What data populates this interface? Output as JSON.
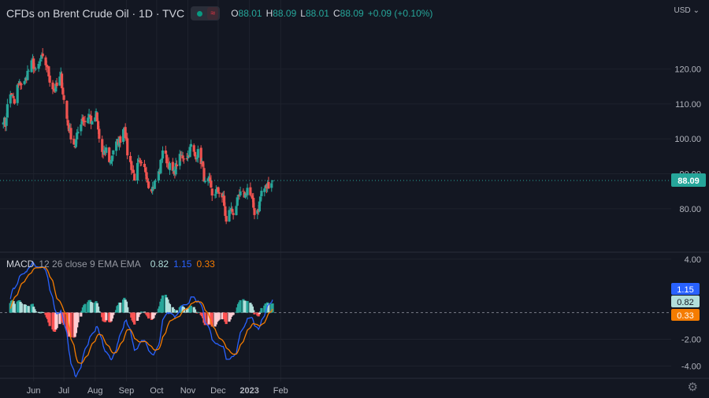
{
  "header": {
    "title": "CFDs on Brent Crude Oil · 1D · TVC",
    "open_label": "O",
    "open": "88.01",
    "high_label": "H",
    "high": "88.09",
    "low_label": "L",
    "low": "88.01",
    "close_label": "C",
    "close": "88.09",
    "change": "+0.09 (+0.10%)",
    "toggle_icon": "eye-dot-icon",
    "wave_icon": "wave-icon"
  },
  "currency": "USD",
  "currency_icon": "chevron-down-icon",
  "settings_icon": "gear-icon",
  "colors": {
    "background": "#131722",
    "grid": "#1e222d",
    "up": "#26a69a",
    "down": "#ef5350",
    "macd_line": "#2962ff",
    "signal_line": "#f57c00",
    "hist_up_strong": "#26a69a",
    "hist_up_weak": "#b2dfdb",
    "hist_down_strong": "#ff5252",
    "hist_down_weak": "#ffcdd2"
  },
  "macd_header": {
    "name": "MACD",
    "params": "12 26 close 9 EMA EMA",
    "hist_value": "0.82",
    "macd_value": "1.15",
    "signal_value": "0.33"
  },
  "chart_data": [
    {
      "type": "candlestick",
      "title": "CFDs on Brent Crude Oil · 1D · TVC",
      "ylim": [
        68,
        133
      ],
      "y_ticks": [
        80,
        90,
        100,
        110,
        120
      ],
      "y_tick_labels": [
        "80.00",
        "90.00",
        "100.00",
        "110.00",
        "120.00"
      ],
      "last_price": 88.09,
      "last_price_label": "88.09",
      "x_tick_labels": [
        "Jun",
        "Jul",
        "Aug",
        "Sep",
        "Oct",
        "Nov",
        "Dec",
        "2023",
        "Feb"
      ],
      "close_anchors": [
        [
          "2022-05-01",
          107
        ],
        [
          "2022-05-04",
          104
        ],
        [
          "2022-05-07",
          112
        ],
        [
          "2022-05-10",
          113
        ],
        [
          "2022-05-13",
          110
        ],
        [
          "2022-05-16",
          115
        ],
        [
          "2022-05-19",
          116
        ],
        [
          "2022-05-23",
          116
        ],
        [
          "2022-05-26",
          119
        ],
        [
          "2022-05-31",
          122
        ],
        [
          "2022-06-03",
          119
        ],
        [
          "2022-06-06",
          121
        ],
        [
          "2022-06-09",
          123
        ],
        [
          "2022-06-14",
          121
        ],
        [
          "2022-06-17",
          117
        ],
        [
          "2022-06-21",
          114
        ],
        [
          "2022-06-24",
          115
        ],
        [
          "2022-06-28",
          118
        ],
        [
          "2022-07-01",
          111
        ],
        [
          "2022-07-05",
          104
        ],
        [
          "2022-07-08",
          101
        ],
        [
          "2022-07-12",
          98
        ],
        [
          "2022-07-15",
          102
        ],
        [
          "2022-07-19",
          106
        ],
        [
          "2022-07-22",
          105
        ],
        [
          "2022-07-26",
          107
        ],
        [
          "2022-07-29",
          104
        ],
        [
          "2022-08-02",
          107
        ],
        [
          "2022-08-05",
          100
        ],
        [
          "2022-08-09",
          95
        ],
        [
          "2022-08-12",
          97
        ],
        [
          "2022-08-16",
          93
        ],
        [
          "2022-08-19",
          97
        ],
        [
          "2022-08-23",
          99
        ],
        [
          "2022-08-26",
          100
        ],
        [
          "2022-08-30",
          104
        ],
        [
          "2022-09-02",
          96
        ],
        [
          "2022-09-06",
          92
        ],
        [
          "2022-09-09",
          89
        ],
        [
          "2022-09-13",
          93
        ],
        [
          "2022-09-16",
          92
        ],
        [
          "2022-09-20",
          91
        ],
        [
          "2022-09-23",
          87
        ],
        [
          "2022-09-27",
          86
        ],
        [
          "2022-09-30",
          88
        ],
        [
          "2022-10-04",
          91
        ],
        [
          "2022-10-07",
          97
        ],
        [
          "2022-10-11",
          94
        ],
        [
          "2022-10-14",
          92
        ],
        [
          "2022-10-18",
          90
        ],
        [
          "2022-10-21",
          93
        ],
        [
          "2022-10-25",
          95
        ],
        [
          "2022-10-28",
          95
        ],
        [
          "2022-11-01",
          95
        ],
        [
          "2022-11-04",
          98
        ],
        [
          "2022-11-08",
          95
        ],
        [
          "2022-11-11",
          96
        ],
        [
          "2022-11-15",
          93
        ],
        [
          "2022-11-18",
          87
        ],
        [
          "2022-11-22",
          88
        ],
        [
          "2022-11-25",
          84
        ],
        [
          "2022-11-29",
          85
        ],
        [
          "2022-12-02",
          85
        ],
        [
          "2022-12-06",
          83
        ],
        [
          "2022-12-09",
          76
        ],
        [
          "2022-12-13",
          80
        ],
        [
          "2022-12-16",
          79
        ],
        [
          "2022-12-20",
          82
        ],
        [
          "2022-12-23",
          84
        ],
        [
          "2022-12-28",
          84
        ],
        [
          "2022-12-30",
          86
        ],
        [
          "2023-01-03",
          83
        ],
        [
          "2023-01-06",
          79
        ],
        [
          "2023-01-10",
          80
        ],
        [
          "2023-01-13",
          85
        ],
        [
          "2023-01-17",
          86
        ],
        [
          "2023-01-20",
          87
        ],
        [
          "2023-01-24",
          88.09
        ]
      ]
    },
    {
      "type": "line",
      "title": "MACD 12 26 close 9 EMA EMA",
      "ylim": [
        -4.8,
        4.4
      ],
      "y_ticks": [
        4,
        -2,
        -4
      ],
      "y_tick_labels": [
        "4.00",
        "-2.00",
        "-4.00"
      ],
      "series": [
        {
          "name": "",
          "role": "histogram",
          "last_value": 0.82,
          "last_value_label": "0.82"
        },
        {
          "name": "",
          "role": "macd",
          "last_value": 1.15,
          "last_value_label": "1.15"
        },
        {
          "name": "",
          "role": "signal",
          "last_value": 0.33,
          "last_value_label": "0.33"
        }
      ]
    }
  ]
}
